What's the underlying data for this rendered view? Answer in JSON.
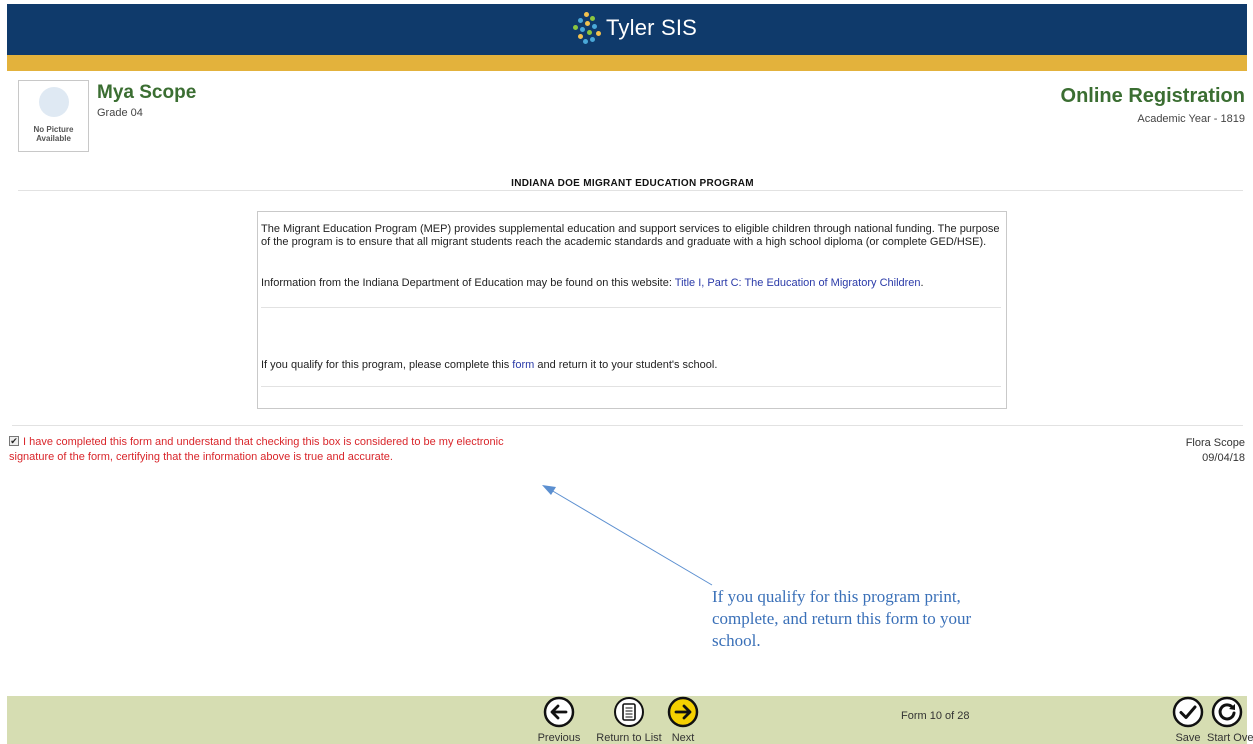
{
  "header": {
    "brand": "Tyler SIS"
  },
  "student": {
    "avatar_text": "No Picture Available",
    "name": "Mya Scope",
    "grade": "Grade 04"
  },
  "registration": {
    "title": "Online Registration",
    "year": "Academic Year - 1819"
  },
  "form": {
    "title": "INDIANA DOE MIGRANT EDUCATION PROGRAM",
    "paragraph1": "The Migrant Education Program (MEP) provides supplemental education and support services to eligible children through national funding. The purpose of the program is to ensure that all migrant students reach the academic standards and graduate with a high school diploma (or complete GED/HSE).",
    "paragraph2_prefix": "Information from the Indiana Department of Education may be found on this website: ",
    "paragraph2_link": "Title I, Part C: The Education of Migratory Children",
    "paragraph2_suffix": ".",
    "paragraph3_prefix": "If you qualify for this program, please complete this ",
    "paragraph3_link": "form",
    "paragraph3_suffix": " and return it to your student's school."
  },
  "signature": {
    "checked": true,
    "text": "I have completed this form and understand that checking this box is considered to be my electronic signature of the form, certifying that the information above is true and accurate.",
    "signer_name": "Flora Scope",
    "date": "09/04/18"
  },
  "annotation": {
    "text": "If you qualify for this program print, complete, and return this form to your school."
  },
  "footer": {
    "previous_label": "Previous",
    "return_label": "Return to List",
    "next_label": "Next",
    "form_count": "Form 10 of 28",
    "save_label": "Save",
    "start_over_label": "Start Over"
  },
  "colors": {
    "header_blue": "#0f3a6b",
    "gold": "#e3b23c",
    "name_green": "#3b6e32",
    "signature_red": "#d9262b",
    "footer_bg": "#d6ddb2",
    "link_blue": "#2a3aa8",
    "annotation_blue": "#3a70b8"
  }
}
